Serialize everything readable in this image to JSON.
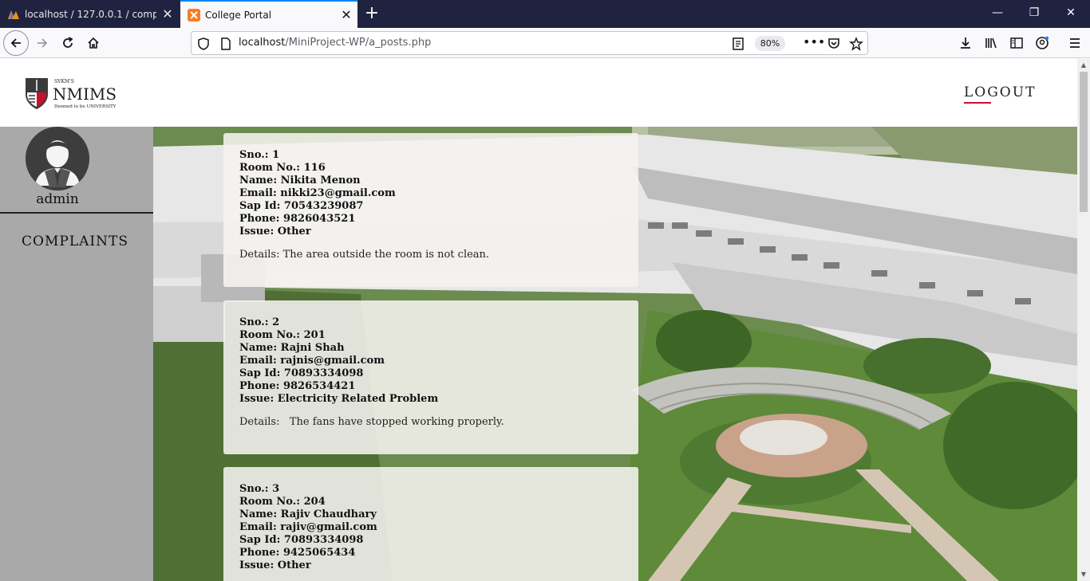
{
  "browser": {
    "tabs": [
      {
        "title": "localhost / 127.0.0.1 / complaints"
      },
      {
        "title": "College Portal"
      }
    ],
    "url_host": "localhost",
    "url_path": "/MiniProject-WP/a_posts.php",
    "zoom": "80%"
  },
  "site": {
    "logo_alt": "SVKM'S NMIMS Deemed to be UNIVERSITY",
    "logo_top": "SVKM'S",
    "logo_main": "NMIMS",
    "logo_sub": "Deemed to be UNIVERSITY",
    "logout_label": "LOGOUT",
    "admin_name": "admin",
    "nav_complaints": "COMPLAINTS"
  },
  "complaints": [
    {
      "sno": "Sno.: 1",
      "room": "Room No.: 116",
      "name": "Name: Nikita Menon",
      "email": "Email: nikki23@gmail.com",
      "sapid": "Sap Id: 70543239087",
      "phone": "Phone: 9826043521",
      "issue": "Issue: Other",
      "details": "Details: The area outside the room is not clean."
    },
    {
      "sno": "Sno.: 2",
      "room": "Room No.: 201",
      "name": "Name: Rajni Shah",
      "email": "Email: rajnis@gmail.com",
      "sapid": "Sap Id: 70893334098",
      "phone": "Phone: 9826534421",
      "issue": "Issue: Electricity Related Problem",
      "details": "Details:   The fans have stopped working properly."
    },
    {
      "sno": "Sno.: 3",
      "room": "Room No.: 204",
      "name": "Name: Rajiv Chaudhary",
      "email": "Email: rajiv@gmail.com",
      "sapid": "Sap Id: 70893334098",
      "phone": "Phone: 9425065434",
      "issue": "Issue: Other",
      "details": ""
    }
  ],
  "colors": {
    "tabbar": "#202340",
    "accent": "#0a84ff",
    "sidebar": "#a9a9a9",
    "brand_red": "#c8102e"
  }
}
